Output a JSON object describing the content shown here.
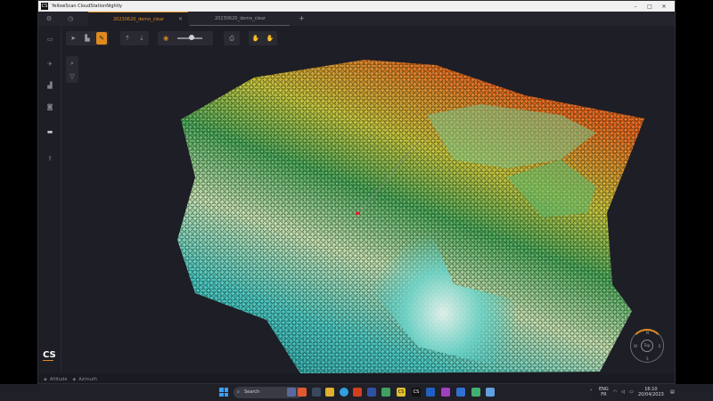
{
  "window": {
    "title": "YellowScan CloudStationNightly",
    "minimize_glyph": "–",
    "maximize_glyph": "□",
    "close_glyph": "✕"
  },
  "tabs": [
    {
      "label": "20230620_demo_clear",
      "active": true
    },
    {
      "label": "20230620_demo_clear",
      "active": false
    }
  ],
  "tab_close_glyph": "×",
  "tab_add_glyph": "+",
  "brand": {
    "logo_text": "CS",
    "accent": "#e08a1e"
  },
  "status": {
    "altitude_label": "Altitude",
    "azimuth_label": "Azimuth"
  },
  "compass": {
    "label": "Top",
    "marks": [
      "N",
      "E",
      "S",
      "W"
    ]
  },
  "taskbar": {
    "search_placeholder": "Search",
    "lang_primary": "ENG",
    "lang_secondary": "FR",
    "time": "16:10",
    "date": "20/04/2023"
  },
  "icons": {
    "settings": "gear-icon",
    "history": "clock-icon",
    "folder": "folder-icon",
    "flight": "plane-icon",
    "chart": "chart-icon",
    "camera": "camera-icon",
    "layers": "layers-icon",
    "export": "export-icon",
    "navigate": "navigate-icon",
    "measure": "measure-icon",
    "pick": "pick-icon",
    "zoom_in": "zoom-in-icon",
    "zoom_out": "zoom-out-icon",
    "eye": "eye-icon",
    "printer": "printer-icon",
    "select": "select-icon",
    "filter": "filter-icon"
  },
  "colors": {
    "background": "#1e1e26",
    "accent": "#e08a1e",
    "cloud_low": "#3fc3c2",
    "cloud_mid": "#3fa050",
    "cloud_high": "#e85a10"
  }
}
